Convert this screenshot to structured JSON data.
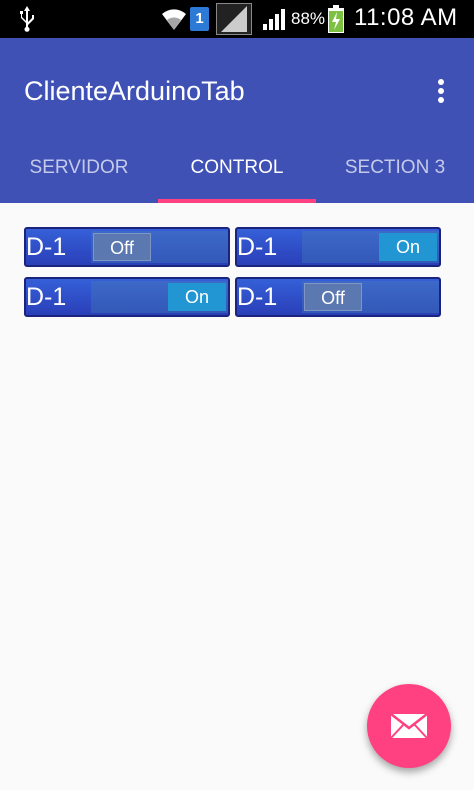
{
  "status_bar": {
    "sim_slot": "1",
    "battery_percent": "88%",
    "time": "11:08 AM"
  },
  "app_bar": {
    "title": "ClienteArduinoTab",
    "menu_icon": "overflow-menu-icon"
  },
  "tabs": [
    {
      "label": "SERVIDOR",
      "active": false
    },
    {
      "label": "CONTROL",
      "active": true
    },
    {
      "label": "SECTION 3",
      "active": false
    }
  ],
  "pins": [
    {
      "label": "D-1",
      "state": "Off"
    },
    {
      "label": "D-1",
      "state": "On"
    },
    {
      "label": "D-1",
      "state": "On"
    },
    {
      "label": "D-1",
      "state": "Off"
    }
  ],
  "fab": {
    "icon": "mail-icon",
    "color": "#ff4081"
  },
  "colors": {
    "primary": "#3f51b5",
    "accent": "#ff4081",
    "switch_on": "#2196d3"
  }
}
